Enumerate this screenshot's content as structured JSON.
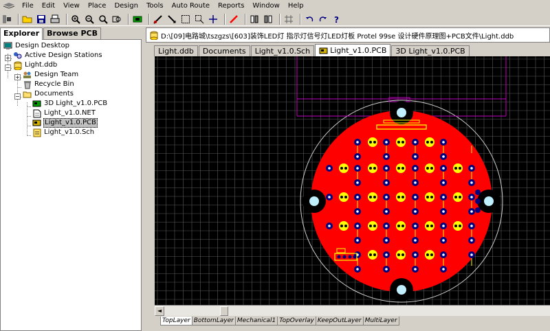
{
  "menubar": {
    "items": [
      "File",
      "Edit",
      "View",
      "Place",
      "Design",
      "Tools",
      "Auto Route",
      "Reports",
      "Window",
      "Help"
    ]
  },
  "toolbar": {
    "icons": [
      "open-folder-icon",
      "save-icon",
      "print-icon",
      "zoom-in-icon",
      "zoom-out-icon",
      "zoom-area-icon",
      "zoom-fit-icon",
      "component-icon",
      "cross-probe-icon",
      "select-icon",
      "move-icon",
      "cross-icon",
      "route-icon",
      "library-icon",
      "grid-icon",
      "undo-icon",
      "redo-icon",
      "help-icon"
    ]
  },
  "explorer": {
    "tabs": [
      "Explorer",
      "Browse PCB"
    ],
    "tree": {
      "root": "Design Desktop",
      "stations": "Active Design Stations",
      "ddb": "Light.ddb",
      "team": "Design Team",
      "recycle": "Recycle Bin",
      "documents": "Documents",
      "files": [
        "3D Light_v1.0.PCB",
        "Light_v1.0.NET",
        "Light_v1.0.PCB",
        "Light_v1.0.Sch"
      ]
    }
  },
  "document": {
    "path": "D:\\[09]电路城\\tszgzs\\[603]装饰LED灯 指示灯信号灯LED灯板 Protel 99se 设计硬件原理图+PCB文件\\Light.ddb",
    "tabs": [
      "Light.ddb",
      "Documents",
      "Light_v1.0.Sch",
      "Light_v1.0.PCB",
      "3D Light_v1.0.PCB"
    ],
    "active_tab": "Light_v1.0.PCB",
    "layers": [
      "TopLayer",
      "BottomLayer",
      "Mechanical1",
      "TopOverlay",
      "KeepOutLayer",
      "MultiLayer"
    ],
    "active_layer": "TopLayer"
  },
  "colors": {
    "board": "#ff0000",
    "canvas": "#000000",
    "grid": "#5a5a5a",
    "pad": "#00007f",
    "overlay": "#ffff00",
    "mechanical": "#c000c0",
    "hole": "#c0f0ff",
    "outline": "#d0d0d0"
  }
}
